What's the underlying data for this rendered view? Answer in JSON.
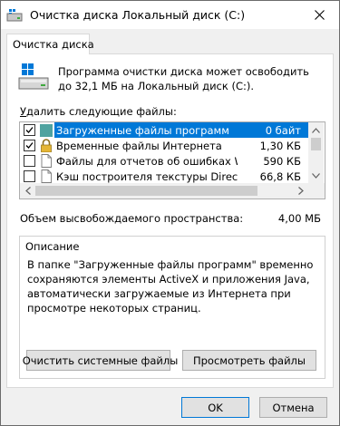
{
  "window": {
    "title": "Очистка диска Локальный диск (C:)"
  },
  "tab": {
    "label": "Очистка диска"
  },
  "intro": "Программа очистки диска может освободить до 32,1 МБ на Локальный диск (C:).",
  "files_label": {
    "underlined": "У",
    "rest": "далить следующие файлы:"
  },
  "files": [
    {
      "name": "Загруженные файлы программ",
      "size": "0 байт",
      "checked": true,
      "selected": true,
      "icon": "teal-folder-icon"
    },
    {
      "name": "Временные файлы Интернета",
      "size": "1,30 КБ",
      "checked": true,
      "selected": false,
      "icon": "lock-icon"
    },
    {
      "name": "Файлы для отчетов об ошибках Win...",
      "size": "590 КБ",
      "checked": false,
      "selected": false,
      "icon": "file-icon"
    },
    {
      "name": "Кэш построителя текстуры DirectX",
      "size": "66,8 КБ",
      "checked": false,
      "selected": false,
      "icon": "file-icon"
    }
  ],
  "space": {
    "label": "Объем высвобождаемого пространства:",
    "value": "4,00 МБ"
  },
  "description": {
    "title": "Описание",
    "text": "В папке \"Загруженные файлы программ\" временно сохраняются элементы ActiveX и приложения Java, автоматически загружаемые из Интернета при просмотре некоторых страниц."
  },
  "buttons": {
    "clean_system": "Очистить системные файлы",
    "view_files": "Просмотреть файлы",
    "ok": "OK",
    "cancel": "Отмена"
  },
  "colors": {
    "selection": "#0078d7",
    "window_bg": "#f0f0f0"
  }
}
